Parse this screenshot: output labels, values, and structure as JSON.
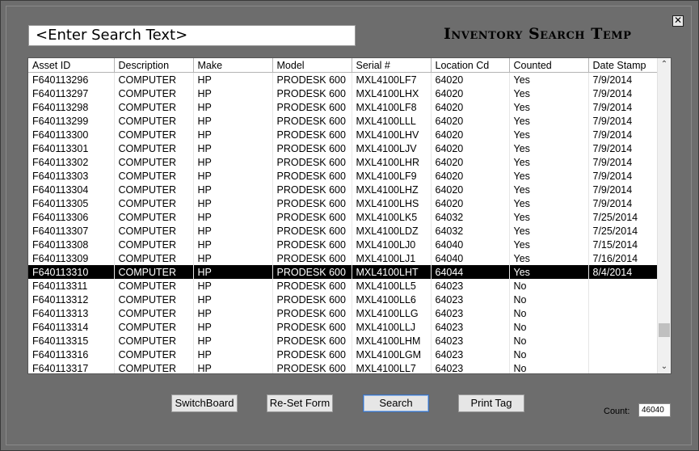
{
  "window": {
    "close_glyph": "✕"
  },
  "search": {
    "placeholder": "<Enter Search Text>"
  },
  "form_title": "Inventory Search Temp",
  "table": {
    "columns": [
      "Asset ID",
      "Description",
      "Make",
      "Model",
      "Serial #",
      "Location Cd",
      "Counted",
      "Date Stamp"
    ],
    "selected_row": 14,
    "rows": [
      [
        "F640113296",
        "COMPUTER",
        "HP",
        "PRODESK 600",
        "MXL4100LF7",
        "64020",
        "Yes",
        "7/9/2014"
      ],
      [
        "F640113297",
        "COMPUTER",
        "HP",
        "PRODESK 600",
        "MXL4100LHX",
        "64020",
        "Yes",
        "7/9/2014"
      ],
      [
        "F640113298",
        "COMPUTER",
        "HP",
        "PRODESK 600",
        "MXL4100LF8",
        "64020",
        "Yes",
        "7/9/2014"
      ],
      [
        "F640113299",
        "COMPUTER",
        "HP",
        "PRODESK 600",
        "MXL4100LLL",
        "64020",
        "Yes",
        "7/9/2014"
      ],
      [
        "F640113300",
        "COMPUTER",
        "HP",
        "PRODESK 600",
        "MXL4100LHV",
        "64020",
        "Yes",
        "7/9/2014"
      ],
      [
        "F640113301",
        "COMPUTER",
        "HP",
        "PRODESK 600",
        "MXL4100LJV",
        "64020",
        "Yes",
        "7/9/2014"
      ],
      [
        "F640113302",
        "COMPUTER",
        "HP",
        "PRODESK 600",
        "MXL4100LHR",
        "64020",
        "Yes",
        "7/9/2014"
      ],
      [
        "F640113303",
        "COMPUTER",
        "HP",
        "PRODESK 600",
        "MXL4100LF9",
        "64020",
        "Yes",
        "7/9/2014"
      ],
      [
        "F640113304",
        "COMPUTER",
        "HP",
        "PRODESK 600",
        "MXL4100LHZ",
        "64020",
        "Yes",
        "7/9/2014"
      ],
      [
        "F640113305",
        "COMPUTER",
        "HP",
        "PRODESK 600",
        "MXL4100LHS",
        "64020",
        "Yes",
        "7/9/2014"
      ],
      [
        "F640113306",
        "COMPUTER",
        "HP",
        "PRODESK 600",
        "MXL4100LK5",
        "64032",
        "Yes",
        "7/25/2014"
      ],
      [
        "F640113307",
        "COMPUTER",
        "HP",
        "PRODESK 600",
        "MXL4100LDZ",
        "64032",
        "Yes",
        "7/25/2014"
      ],
      [
        "F640113308",
        "COMPUTER",
        "HP",
        "PRODESK 600",
        "MXL4100LJ0",
        "64040",
        "Yes",
        "7/15/2014"
      ],
      [
        "F640113309",
        "COMPUTER",
        "HP",
        "PRODESK 600",
        "MXL4100LJ1",
        "64040",
        "Yes",
        "7/16/2014"
      ],
      [
        "F640113310",
        "COMPUTER",
        "HP",
        "PRODESK 600",
        "MXL4100LHT",
        "64044",
        "Yes",
        "8/4/2014"
      ],
      [
        "F640113311",
        "COMPUTER",
        "HP",
        "PRODESK 600",
        "MXL4100LL5",
        "64023",
        "No",
        ""
      ],
      [
        "F640113312",
        "COMPUTER",
        "HP",
        "PRODESK 600",
        "MXL4100LL6",
        "64023",
        "No",
        ""
      ],
      [
        "F640113313",
        "COMPUTER",
        "HP",
        "PRODESK 600",
        "MXL4100LLG",
        "64023",
        "No",
        ""
      ],
      [
        "F640113314",
        "COMPUTER",
        "HP",
        "PRODESK 600",
        "MXL4100LLJ",
        "64023",
        "No",
        ""
      ],
      [
        "F640113315",
        "COMPUTER",
        "HP",
        "PRODESK 600",
        "MXL4100LHM",
        "64023",
        "No",
        ""
      ],
      [
        "F640113316",
        "COMPUTER",
        "HP",
        "PRODESK 600",
        "MXL4100LGM",
        "64023",
        "No",
        ""
      ],
      [
        "F640113317",
        "COMPUTER",
        "HP",
        "PRODESK 600",
        "MXL4100LL7",
        "64023",
        "No",
        ""
      ]
    ]
  },
  "scrollbar": {
    "up_glyph": "⌃",
    "down_glyph": "⌄"
  },
  "buttons": {
    "switchboard": "SwitchBoard",
    "reset": "Re-Set Form",
    "search": "Search",
    "print_tag": "Print Tag"
  },
  "count": {
    "label": "Count:",
    "value": "46040"
  }
}
